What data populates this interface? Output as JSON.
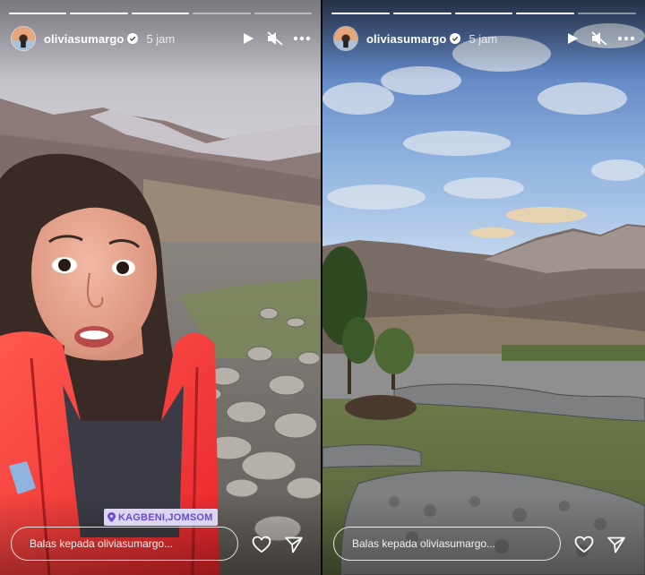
{
  "stories": [
    {
      "username": "oliviasumargo",
      "time": "5 jam",
      "location": "KAGBENI,JOMSOM",
      "reply_placeholder": "Balas kepada oliviasumargo...",
      "progress_total": 5,
      "progress_done": 3
    },
    {
      "username": "oliviasumargo",
      "time": "5 jam",
      "reply_placeholder": "Balas kepada oliviasumargo...",
      "progress_total": 5,
      "progress_done": 4
    }
  ],
  "icons": {
    "play": "play-icon",
    "mute": "speaker-muted-icon",
    "more": "more-options-icon",
    "like": "heart-icon",
    "share": "send-icon",
    "verified": "verified-badge-icon",
    "location": "location-pin-icon"
  },
  "colors": {
    "sticker_bg": "#dcd6f0",
    "sticker_text": "#6c4ad0",
    "jacket": "#ff3b3b",
    "sky_left": "#e9e6ea",
    "sky_right": "#5f8fd0"
  }
}
